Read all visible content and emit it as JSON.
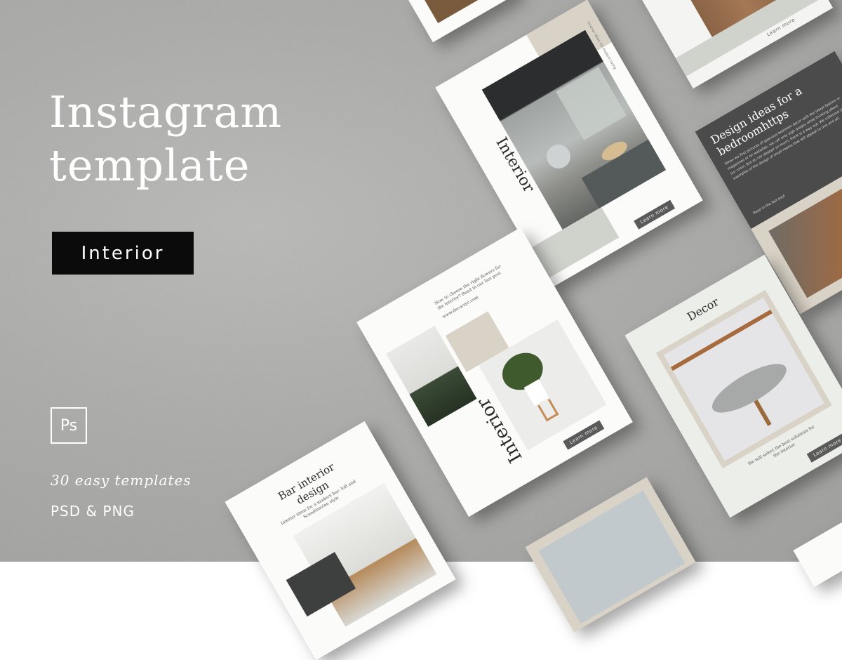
{
  "promo": {
    "title_line1": "Instagram",
    "title_line2": "template",
    "badge": "Interior",
    "ps_icon": "Ps",
    "tagline": "30 easy templates",
    "formats": "PSD & PNG"
  },
  "cards": {
    "top_right": {
      "cta": "Learn more"
    },
    "interior_main": {
      "vertical_title": "Interior",
      "side_text": "Interior ideas for modern living",
      "cta": "Learn more"
    },
    "design_ideas": {
      "heading": "Design ideas for a bedroomhttps",
      "body": "When we first pictures of spacious bedroom decor with the latest fashion in magazines or on websites, we can only sigh deeply while thinking about our room. But do not despair so much, there is a way out. We collected 20 examples of the design of small rooms that will appeal to one and all.",
      "link": "Read in the last post"
    },
    "interior_plant": {
      "text_block": "How to choose the right flowers for the interior? Read in our last post",
      "url": "www.decorzyc.com",
      "vertical_title": "Interior",
      "cta": "Learn more"
    },
    "decor": {
      "heading": "Decor",
      "caption": "We will select the best solutions for the interior",
      "cta": "Learn more"
    },
    "bar_design": {
      "heading_line1": "Bar interior",
      "heading_line2": "design",
      "sub": "Interior ideas for a modern bar: loft and Scandinavian style"
    }
  },
  "colors": {
    "badge_bg": "#0b0b0b",
    "text_light": "#ffffff",
    "cta_bg": "#5a5a5a",
    "dark_panel": "#4b4b4b",
    "beige": "#d9d2c6",
    "sage": "#d0d2cc"
  }
}
